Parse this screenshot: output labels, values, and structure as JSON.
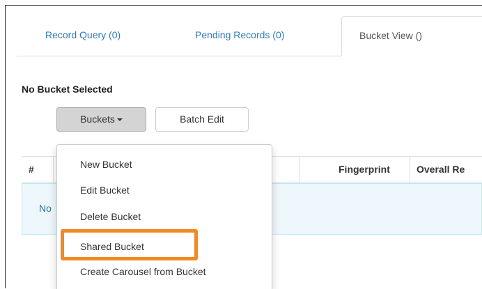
{
  "tabs": [
    {
      "label": "Record Query (0)"
    },
    {
      "label": "Pending Records (0)"
    },
    {
      "label": "Bucket View ()"
    }
  ],
  "bucket": {
    "title": "No Bucket Selected",
    "buckets_button": "Buckets",
    "batch_edit_button": "Batch Edit"
  },
  "table": {
    "columns": [
      "#",
      "",
      "Fingerprint",
      "Overall Re"
    ],
    "empty_text": "No"
  },
  "dropdown": {
    "items": [
      "New Bucket",
      "Edit Bucket",
      "Delete Bucket",
      "Shared Bucket",
      "Create Carousel from Bucket"
    ],
    "highlighted_item": "Shared Bucket"
  },
  "colors": {
    "link": "#337ab7",
    "highlight_border": "#f08a24",
    "info_bg": "#eef7fb",
    "info_text": "#31708f"
  }
}
